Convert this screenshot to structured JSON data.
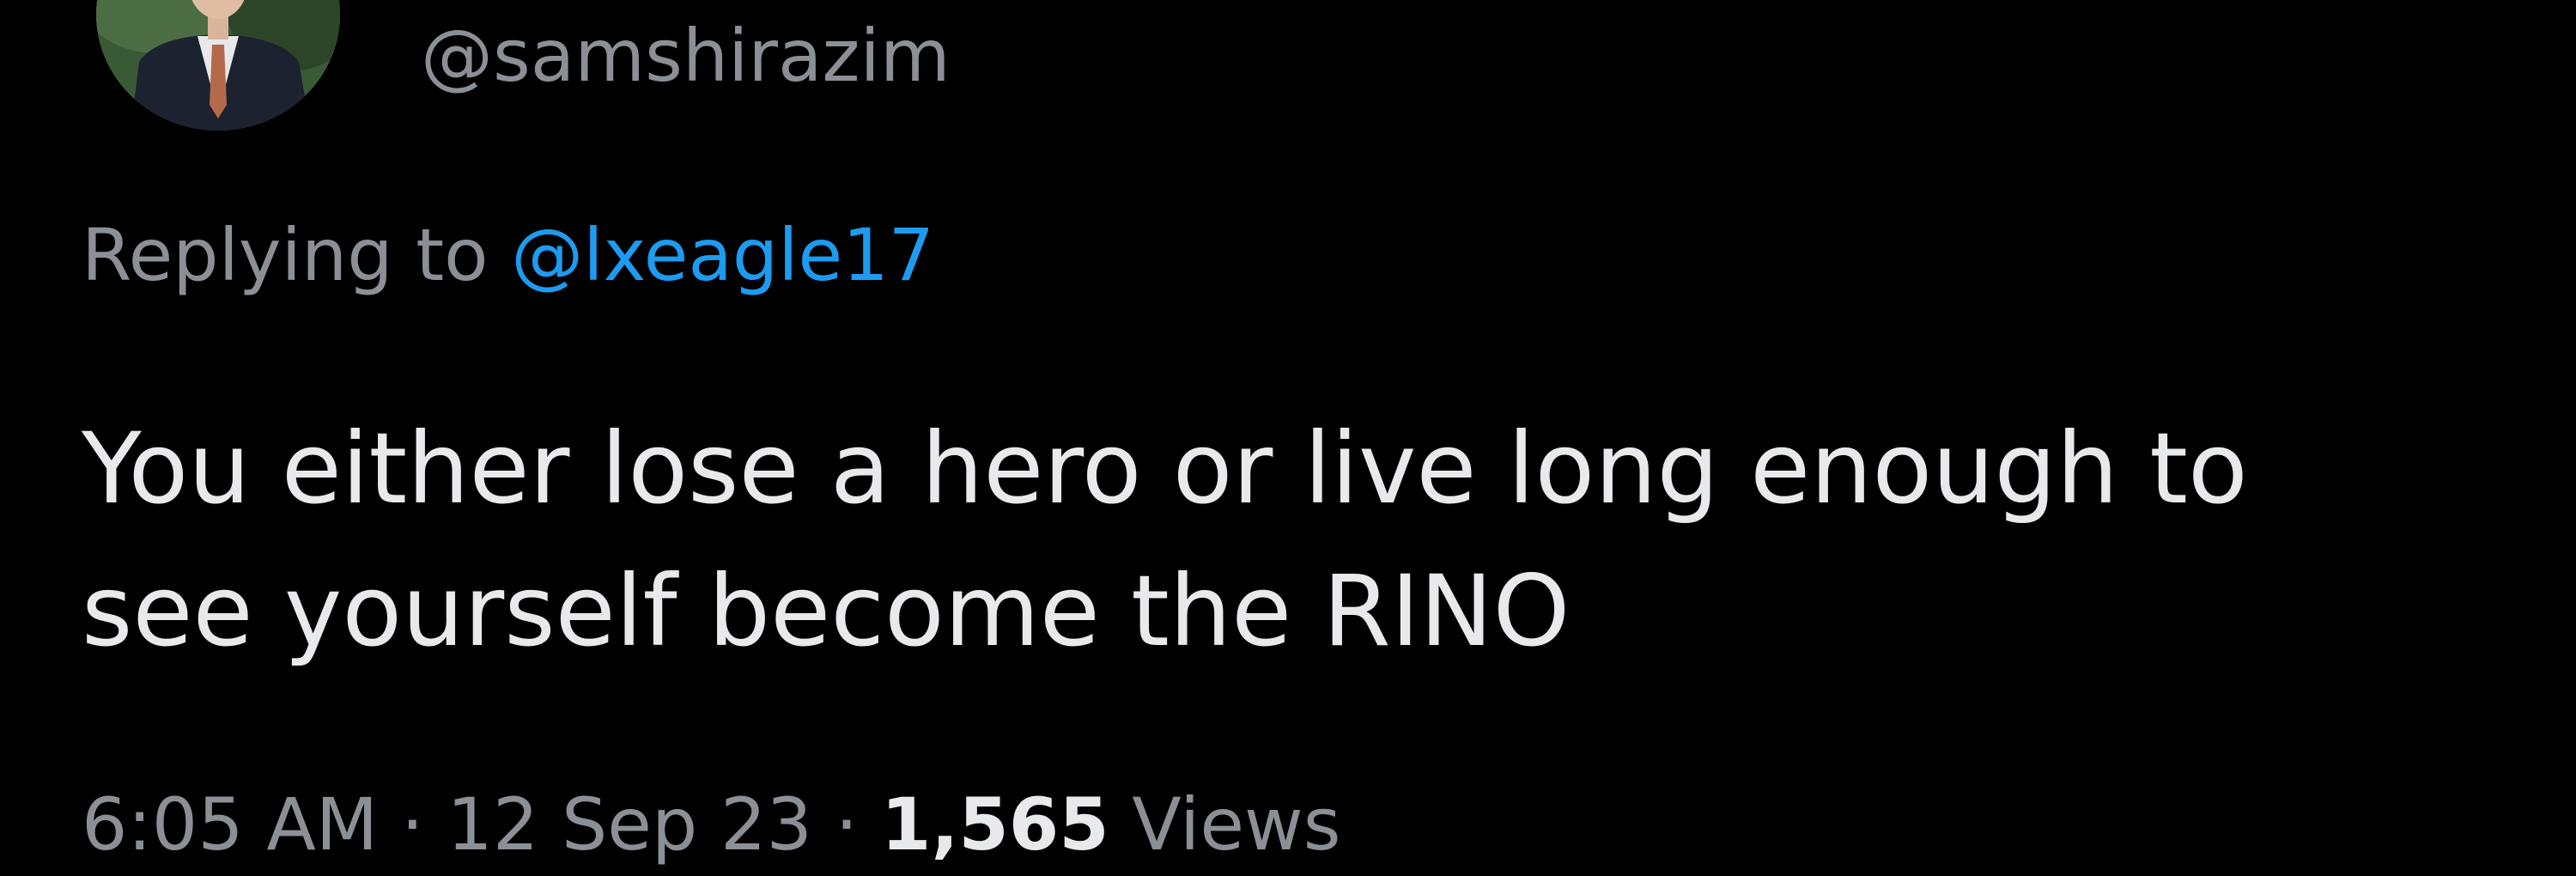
{
  "tweet": {
    "handle": "@samshirazim",
    "replying_prefix": "Replying to ",
    "replying_to": "@lxeagle17",
    "text_lines": [
      "You either lose a hero or live long enough to",
      "see yourself become the RINO"
    ],
    "time": "6:05 AM",
    "separator": " · ",
    "date": "12 Sep 23",
    "views_count": "1,565",
    "views_label": " Views",
    "more_icon": "more-dots-icon",
    "colors": {
      "background": "#000000",
      "primary_text": "#e7e9ea",
      "secondary_text": "#8b9096",
      "link": "#1d9bf0"
    }
  }
}
